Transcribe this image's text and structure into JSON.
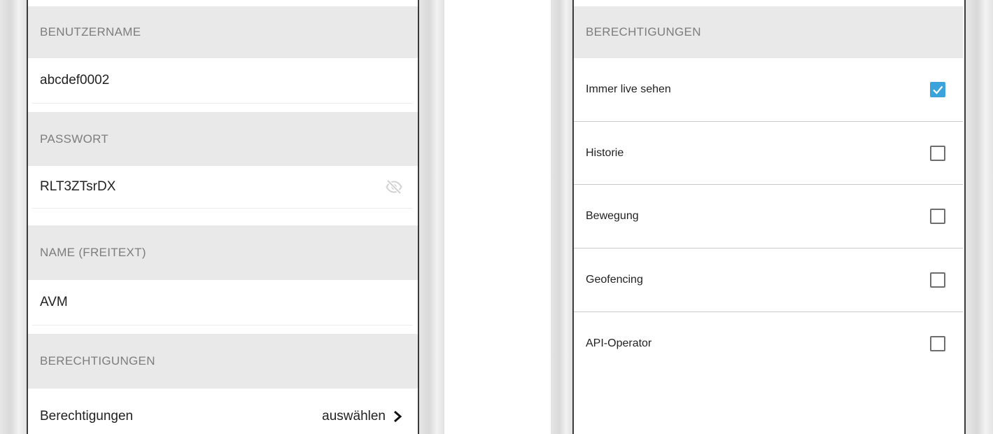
{
  "left_screen": {
    "username_header": "BENUTZERNAME",
    "username_value": "abcdef0002",
    "password_header": "PASSWORT",
    "password_value": "RLT3ZTsrDX",
    "name_header": "NAME (FREITEXT)",
    "name_value": "AVM",
    "permissions_header": "BERECHTIGUNGEN",
    "permissions_row_label": "Berechtigungen",
    "permissions_row_action": "auswählen"
  },
  "right_screen": {
    "header": "BERECHTIGUNGEN",
    "items": [
      {
        "label": "Immer live sehen",
        "checked": true
      },
      {
        "label": "Historie",
        "checked": false
      },
      {
        "label": "Bewegung",
        "checked": false
      },
      {
        "label": "Geofencing",
        "checked": false
      },
      {
        "label": "API-Operator",
        "checked": false
      }
    ]
  },
  "colors": {
    "checkbox_checked": "#3aa3db",
    "section_header_bg": "#e9e9e9"
  },
  "icons": {
    "password_visibility": "eye-off-icon",
    "navigate": "chevron-right-icon",
    "check": "checkmark-icon"
  }
}
